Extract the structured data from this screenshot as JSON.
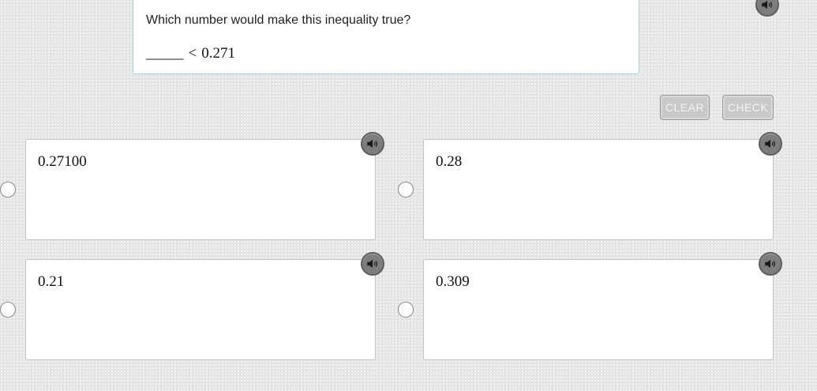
{
  "question": {
    "prompt": "Which number would make this inequality true?",
    "blank": "_____",
    "operator": "<",
    "value": "0.271"
  },
  "buttons": {
    "clear": "CLEAR",
    "check": "CHECK"
  },
  "options": [
    {
      "label": "0.27100"
    },
    {
      "label": "0.28"
    },
    {
      "label": "0.21"
    },
    {
      "label": "0.309"
    }
  ],
  "colors": {
    "accent_border": "#9fd3dc",
    "audio_button": "#7d7d7d",
    "disabled_button": "#c9c9c9"
  },
  "icons": {
    "audio": "speaker-icon",
    "radio": "radio-button"
  }
}
